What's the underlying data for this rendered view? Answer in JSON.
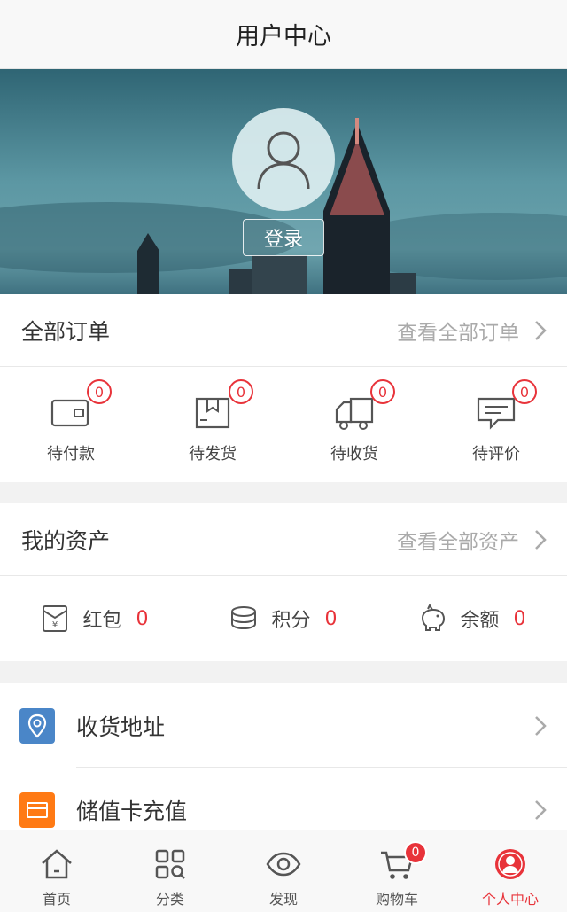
{
  "header": {
    "title": "用户中心"
  },
  "banner": {
    "login_label": "登录"
  },
  "orders": {
    "label": "全部订单",
    "link": "查看全部订单",
    "items": [
      {
        "label": "待付款",
        "count": "0",
        "icon": "wallet-icon"
      },
      {
        "label": "待发货",
        "count": "0",
        "icon": "package-icon"
      },
      {
        "label": "待收货",
        "count": "0",
        "icon": "truck-icon"
      },
      {
        "label": "待评价",
        "count": "0",
        "icon": "comment-icon"
      }
    ]
  },
  "assets": {
    "label": "我的资产",
    "link": "查看全部资产",
    "items": [
      {
        "label": "红包",
        "value": "0",
        "icon": "red-envelope-icon"
      },
      {
        "label": "积分",
        "value": "0",
        "icon": "coins-icon"
      },
      {
        "label": "余额",
        "value": "0",
        "icon": "piggy-bank-icon"
      }
    ]
  },
  "menu": [
    {
      "label": "收货地址",
      "icon": "location-icon",
      "color": "#4a86c8"
    },
    {
      "label": "储值卡充值",
      "icon": "card-icon",
      "color": "#ff7a14"
    }
  ],
  "tabbar": {
    "items": [
      {
        "label": "首页",
        "icon": "home-icon"
      },
      {
        "label": "分类",
        "icon": "category-icon"
      },
      {
        "label": "发现",
        "icon": "eye-icon"
      },
      {
        "label": "购物车",
        "icon": "cart-icon",
        "badge": "0"
      },
      {
        "label": "个人中心",
        "icon": "user-icon",
        "active": true
      }
    ]
  },
  "colors": {
    "accent": "#e8333a",
    "location": "#4a86c8",
    "card": "#ff7a14"
  }
}
